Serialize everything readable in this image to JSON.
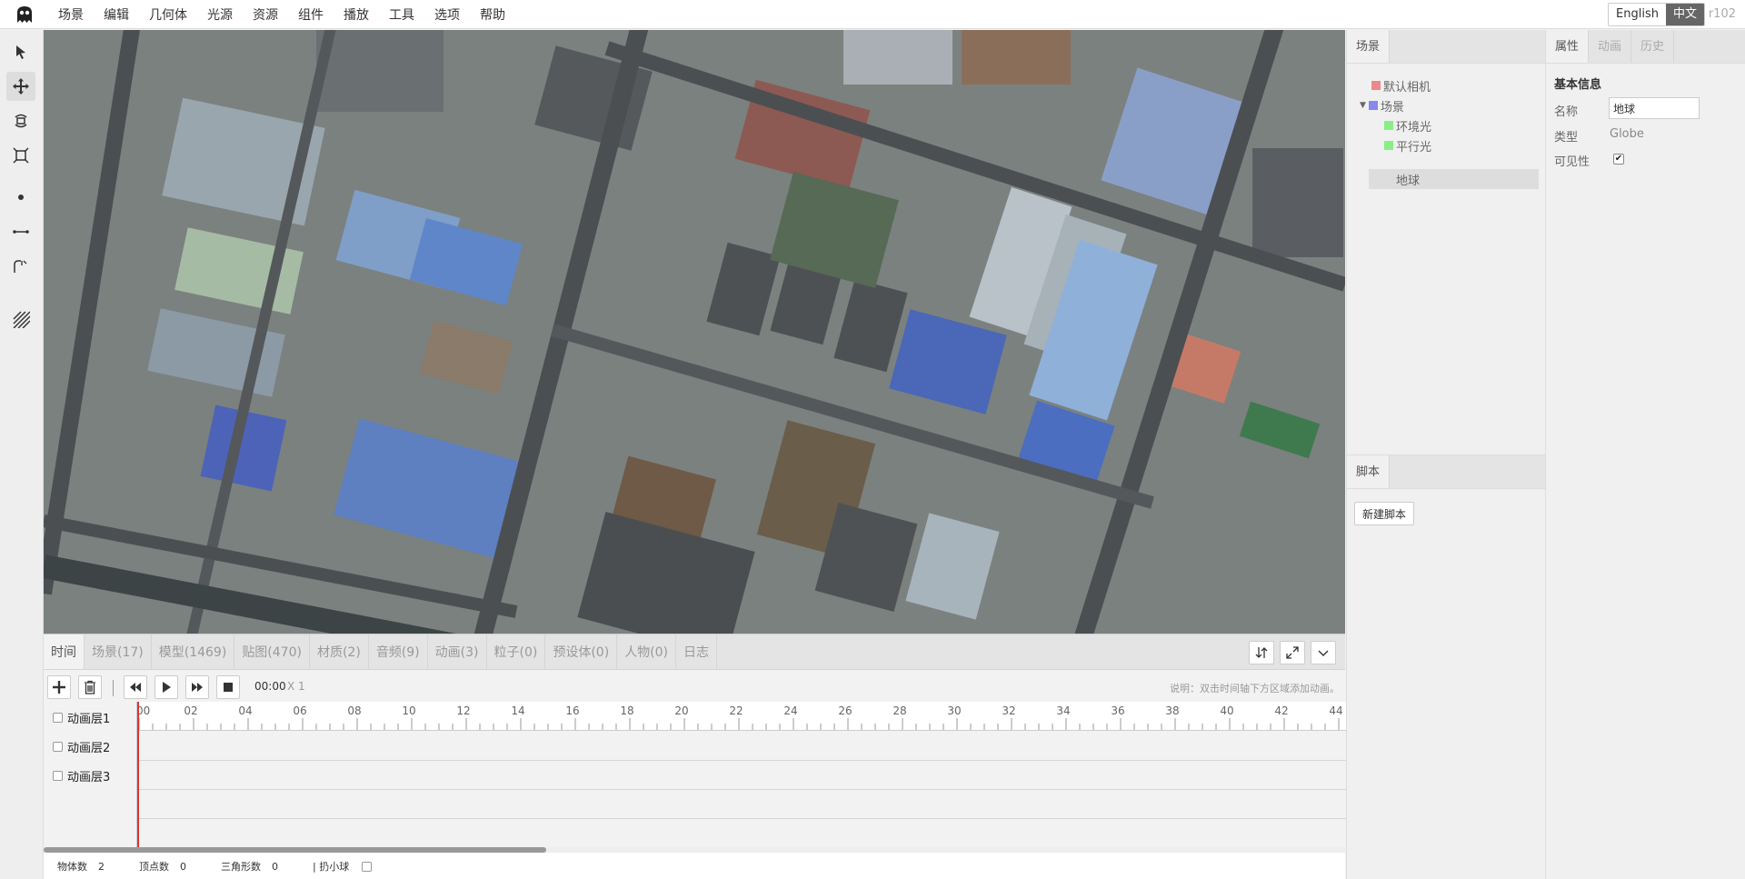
{
  "menu": {
    "items": [
      "场景",
      "编辑",
      "几何体",
      "光源",
      "资源",
      "组件",
      "播放",
      "工具",
      "选项",
      "帮助"
    ],
    "languages": [
      "English",
      "中文"
    ],
    "active_language": "中文",
    "version": "r102"
  },
  "toolbar": {
    "tools": [
      "select-tool",
      "translate-tool",
      "rotate-tool",
      "scale-tool",
      "point-tool",
      "line-tool",
      "polyline-tool",
      "hatch-tool"
    ],
    "active_tool": "translate-tool"
  },
  "bottom_panel": {
    "tabs": [
      "时间",
      "场景(17)",
      "模型(1469)",
      "贴图(470)",
      "材质(2)",
      "音频(9)",
      "动画(3)",
      "粒子(0)",
      "预设体(0)",
      "人物(0)",
      "日志"
    ],
    "active_tab": "时间",
    "time": "00:00",
    "speed": "X 1",
    "hint": "说明：双击时间轴下方区域添加动画。",
    "ruler_labels": [
      "00",
      "02",
      "04",
      "06",
      "08",
      "10",
      "12",
      "14",
      "16",
      "18",
      "20",
      "22",
      "24",
      "26",
      "28",
      "30",
      "32",
      "34",
      "36",
      "38",
      "40",
      "42",
      "44"
    ],
    "layers": [
      "动画层1",
      "动画层2",
      "动画层3"
    ]
  },
  "status": {
    "objects_label": "物体数",
    "objects": "2",
    "vertices_label": "顶点数",
    "vertices": "0",
    "triangles_label": "三角形数",
    "triangles": "0",
    "ball_label": "| 扔小球"
  },
  "scene_panel": {
    "tab": "场景",
    "tree": [
      {
        "label": "默认相机",
        "color": "#ee8888"
      },
      {
        "label": "场景",
        "color": "#8888ee"
      },
      {
        "label": "环境光",
        "color": "#88ee88"
      },
      {
        "label": "平行光",
        "color": "#88ee88"
      },
      {
        "label": "地球",
        "color": "#dddddd"
      }
    ],
    "selected": "地球"
  },
  "script_panel": {
    "tab": "脚本",
    "new_button": "新建脚本"
  },
  "prop_panel": {
    "tabs": [
      "属性",
      "动画",
      "历史"
    ],
    "active_tab": "属性",
    "section_title": "基本信息",
    "name_label": "名称",
    "name_value": "地球",
    "type_label": "类型",
    "type_value": "Globe",
    "visible_label": "可见性",
    "visible": true
  }
}
